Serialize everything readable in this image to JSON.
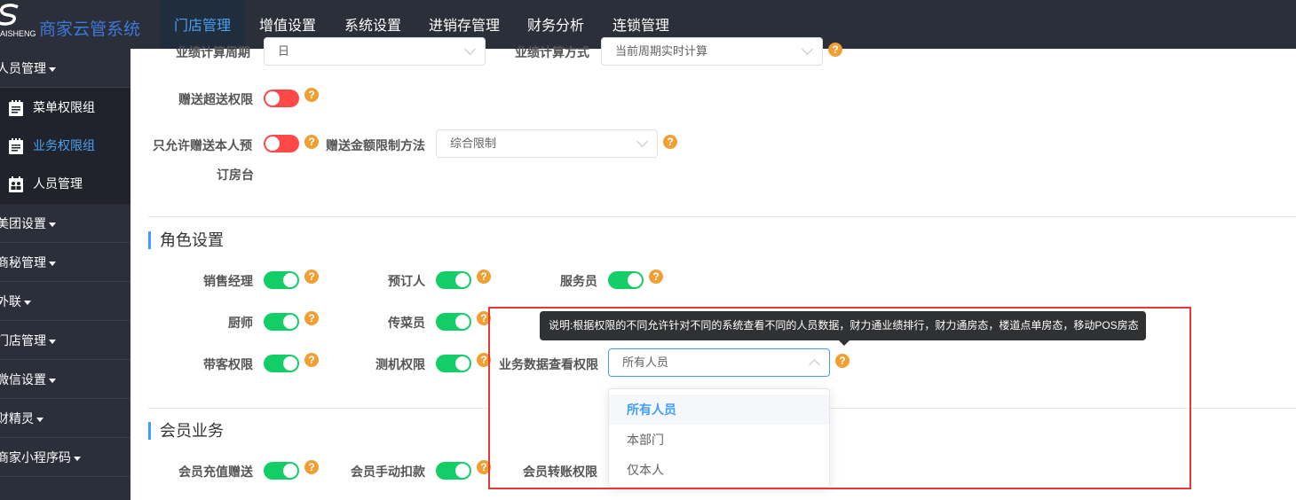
{
  "app": {
    "logo_sub": "AISHENG",
    "title": "商家云管系统"
  },
  "topnav": [
    "门店管理",
    "增值设置",
    "系统设置",
    "进销存管理",
    "财务分析",
    "连锁管理"
  ],
  "sidebar": {
    "groups": [
      "人员管理",
      "美团设置",
      "商秘管理",
      "外联",
      "门店管理",
      "微信设置",
      "财精灵",
      "商家小程序码"
    ],
    "subitems": [
      "菜单权限组",
      "业务权限组",
      "人员管理"
    ]
  },
  "form": {
    "perf_period_label": "业绩计算周期",
    "perf_period_value": "日",
    "perf_method_label": "业绩计算方式",
    "perf_method_value": "当前周期实时计算",
    "gift_over_label": "赠送超送权限",
    "only_self_label_1": "只允许赠送本人预",
    "only_self_label_2": "订房台",
    "gift_amount_label": "赠送金额限制方法",
    "gift_amount_value": "综合限制"
  },
  "role_section": {
    "title": "角色设置",
    "row1": [
      "销售经理",
      "预订人",
      "服务员"
    ],
    "row2": [
      "厨师",
      "传菜员"
    ],
    "row3": [
      "带客权限",
      "测机权限"
    ],
    "biz_view_label": "业务数据查看权限",
    "biz_view_value": "所有人员"
  },
  "member_section": {
    "title": "会员业务",
    "items": [
      "会员充值赠送",
      "会员手动扣款",
      "会员转账权限"
    ]
  },
  "tooltip": "说明:根据权限的不同允许针对不同的系统查看不同的人员数据，财力通业绩排行，财力通房态，楼道点单房态，移动POS房态",
  "dropdown": [
    "所有人员",
    "本部门",
    "仅本人"
  ],
  "help_glyph": "?",
  "colors": {
    "toggle_on": "#13ce66",
    "toggle_off": "#ff4949",
    "accent": "#409eff",
    "help": "#f0a032",
    "sidebar": "#2b2f3a",
    "highlight": "#e53935"
  }
}
